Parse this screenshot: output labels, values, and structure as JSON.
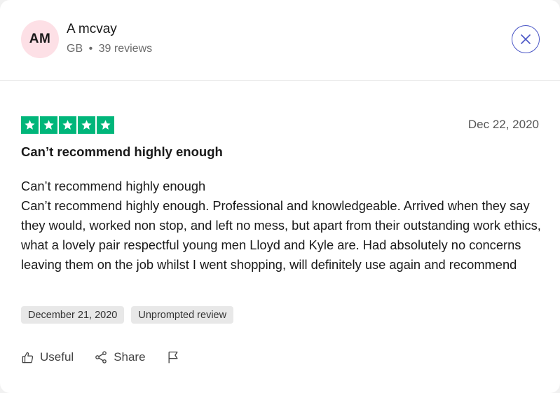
{
  "reviewer": {
    "initials": "AM",
    "name": "A mcvay",
    "country": "GB",
    "separator": "•",
    "reviews_count": "39 reviews"
  },
  "review": {
    "rating": 5,
    "rating_color": "#00b67a",
    "date": "Dec 22, 2020",
    "title": "Can’t recommend highly enough",
    "body_lines": [
      "Can’t recommend highly enough",
      "Can’t recommend highly enough. Professional and knowledgeable. Arrived when they say they would, worked non stop, and left no mess, but apart from their outstanding work ethics, what a lovely pair respectful young men Lloyd and Kyle are. Had absolutely no concerns leaving them on the job whilst I went shopping, will definitely use again and recommend"
    ],
    "tags": [
      "December 21, 2020",
      "Unprompted review"
    ]
  },
  "actions": {
    "useful_label": "Useful",
    "share_label": "Share",
    "icons": [
      "thumbs-up-icon",
      "share-icon",
      "flag-icon",
      "close-icon",
      "star-icon"
    ]
  }
}
